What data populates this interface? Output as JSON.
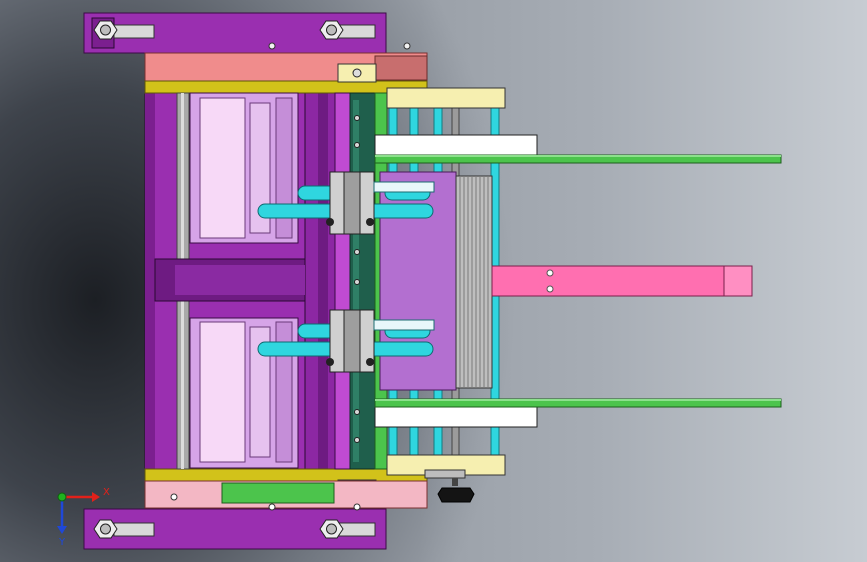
{
  "viewport": {
    "background_dark": "#1c1f24",
    "background_light": "#c7ccd2"
  },
  "model": {
    "palette": {
      "purple": "#9a2fb0",
      "purple_dark": "#6e1b82",
      "lavender": "#d6a4e8",
      "light_pink": "#f7d9f7",
      "salmon": "#f08c8c",
      "yellow": "#d2c21a",
      "cream": "#f6efb0",
      "cyan": "#2fd6df",
      "green": "#4cc44c",
      "dark_green": "#1f5f4c",
      "hot_pink": "#ff6fb0",
      "gray_block": "#b9b9b9",
      "white": "#ffffff",
      "black": "#111111"
    }
  },
  "triad": {
    "x_label": "X",
    "y_label": "Y",
    "x_color": "#e2211a",
    "y_color": "#1f48d8",
    "z_color": "#1fb21f"
  }
}
